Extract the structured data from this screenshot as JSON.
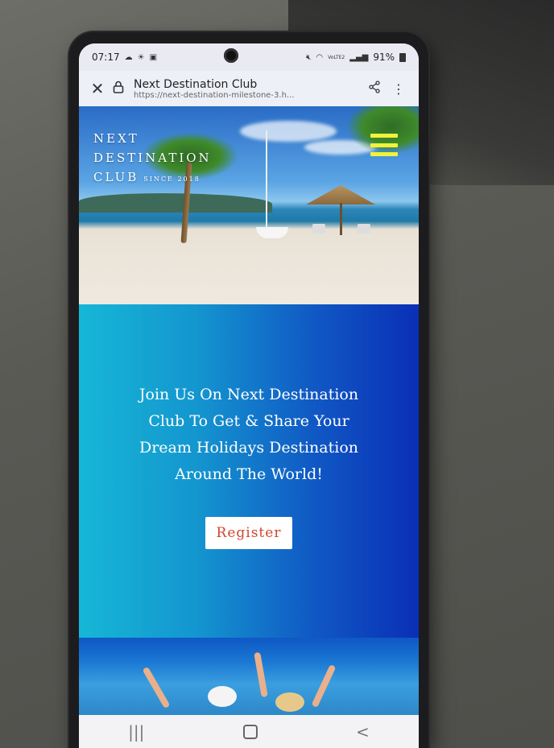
{
  "status_bar": {
    "time": "07:17",
    "battery": "91%",
    "network": "VoLTE2",
    "icons": [
      "cloud-icon",
      "sun-icon",
      "photo-icon",
      "mute-icon",
      "wifi-icon",
      "signal-icon",
      "battery-icon"
    ]
  },
  "browser": {
    "page_title": "Next Destination Club",
    "url": "https://next-destination-milestone-3.h...",
    "icons": [
      "close-icon",
      "lock-icon",
      "share-icon",
      "more-vert-icon"
    ]
  },
  "site": {
    "brand_line1": "NEXT",
    "brand_line2": "DESTINATION",
    "brand_line3": "CLUB",
    "brand_since": "SINCE 2018",
    "menu_icon": "hamburger-icon",
    "menu_color": "#f2f23a",
    "cta_text": "Join Us On Next Destination Club To Get & Share Your Dream Holidays Destination Around The World!",
    "register_label": "Register",
    "register_color": "#d2452f"
  },
  "nav_bar": {
    "recents": "|||",
    "back": "<",
    "icons": [
      "recents-icon",
      "home-icon",
      "back-icon"
    ]
  }
}
